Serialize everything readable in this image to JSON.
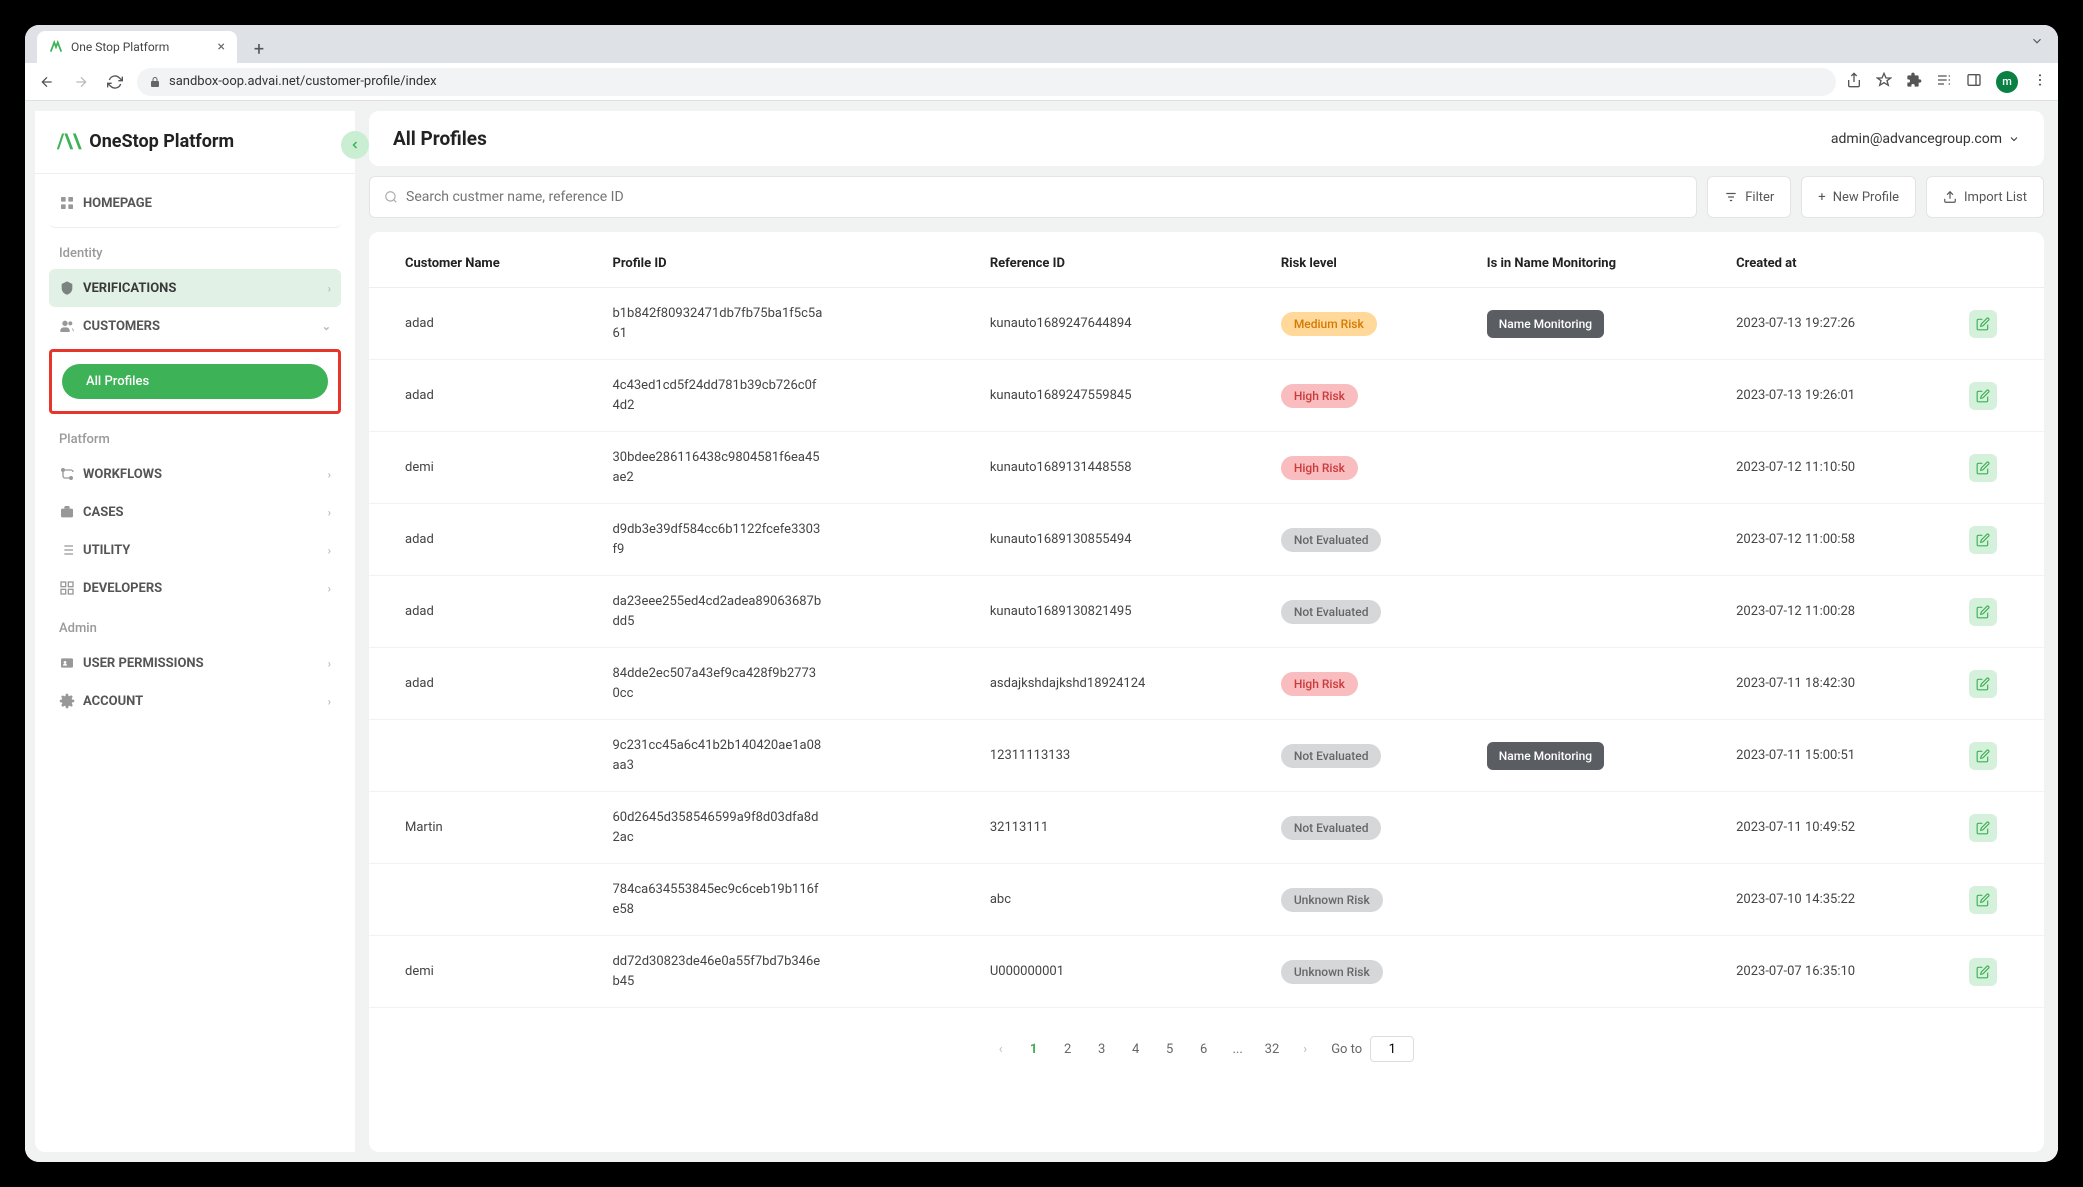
{
  "browser": {
    "tab_title": "One Stop Platform",
    "url": "sandbox-oop.advai.net/customer-profile/index",
    "avatar_letter": "m"
  },
  "sidebar": {
    "brand": "OneStop Platform",
    "items": {
      "homepage": "HOMEPAGE",
      "identity_label": "Identity",
      "verifications": "VERIFICATIONS",
      "customers": "CUSTOMERS",
      "all_profiles": "All Profiles",
      "platform_label": "Platform",
      "workflows": "WORKFLOWS",
      "cases": "CASES",
      "utility": "UTILITY",
      "developers": "DEVELOPERS",
      "admin_label": "Admin",
      "user_permissions": "USER PERMISSIONS",
      "account": "ACCOUNT"
    }
  },
  "header": {
    "title": "All Profiles",
    "user_email": "admin@advancegroup.com"
  },
  "toolbar": {
    "search_placeholder": "Search custmer name, reference ID",
    "filter": "Filter",
    "new_profile": "New Profile",
    "import_list": "Import List"
  },
  "table": {
    "columns": {
      "customer_name": "Customer Name",
      "profile_id": "Profile ID",
      "reference_id": "Reference ID",
      "risk_level": "Risk level",
      "monitoring": "Is in Name Monitoring",
      "created_at": "Created at"
    },
    "rows": [
      {
        "name": "adad",
        "profile_id": "b1b842f80932471db7fb75ba1f5c5a61",
        "reference_id": "kunauto1689247644894",
        "risk": "Medium Risk",
        "risk_class": "medium",
        "monitoring": "Name Monitoring",
        "created_at": "2023-07-13 19:27:26"
      },
      {
        "name": "adad",
        "profile_id": "4c43ed1cd5f24dd781b39cb726c0f4d2",
        "reference_id": "kunauto1689247559845",
        "risk": "High Risk",
        "risk_class": "high",
        "monitoring": "",
        "created_at": "2023-07-13 19:26:01"
      },
      {
        "name": "demi",
        "profile_id": "30bdee286116438c9804581f6ea45ae2",
        "reference_id": "kunauto1689131448558",
        "risk": "High Risk",
        "risk_class": "high",
        "monitoring": "",
        "created_at": "2023-07-12 11:10:50"
      },
      {
        "name": "adad",
        "profile_id": "d9db3e39df584cc6b1122fcefe3303f9",
        "reference_id": "kunauto1689130855494",
        "risk": "Not Evaluated",
        "risk_class": "noteval",
        "monitoring": "",
        "created_at": "2023-07-12 11:00:58"
      },
      {
        "name": "adad",
        "profile_id": "da23eee255ed4cd2adea89063687bdd5",
        "reference_id": "kunauto1689130821495",
        "risk": "Not Evaluated",
        "risk_class": "noteval",
        "monitoring": "",
        "created_at": "2023-07-12 11:00:28"
      },
      {
        "name": "adad",
        "profile_id": "84dde2ec507a43ef9ca428f9b27730cc",
        "reference_id": "asdajkshdajkshd18924124",
        "risk": "High Risk",
        "risk_class": "high",
        "monitoring": "",
        "created_at": "2023-07-11 18:42:30"
      },
      {
        "name": "",
        "profile_id": "9c231cc45a6c41b2b140420ae1a08aa3",
        "reference_id": "12311113133",
        "risk": "Not Evaluated",
        "risk_class": "noteval",
        "monitoring": "Name Monitoring",
        "created_at": "2023-07-11 15:00:51"
      },
      {
        "name": "Martin",
        "profile_id": "60d2645d358546599a9f8d03dfa8d2ac",
        "reference_id": "32113111",
        "risk": "Not Evaluated",
        "risk_class": "noteval",
        "monitoring": "",
        "created_at": "2023-07-11 10:49:52"
      },
      {
        "name": "",
        "profile_id": "784ca634553845ec9c6ceb19b116fe58",
        "reference_id": "abc",
        "risk": "Unknown Risk",
        "risk_class": "unknown",
        "monitoring": "",
        "created_at": "2023-07-10 14:35:22"
      },
      {
        "name": "demi",
        "profile_id": "dd72d30823de46e0a55f7bd7b346eb45",
        "reference_id": "U000000001",
        "risk": "Unknown Risk",
        "risk_class": "unknown",
        "monitoring": "",
        "created_at": "2023-07-07 16:35:10"
      }
    ]
  },
  "pagination": {
    "pages": [
      "1",
      "2",
      "3",
      "4",
      "5",
      "6",
      "...",
      "32"
    ],
    "current": "1",
    "goto_label": "Go to",
    "goto_value": "1"
  }
}
